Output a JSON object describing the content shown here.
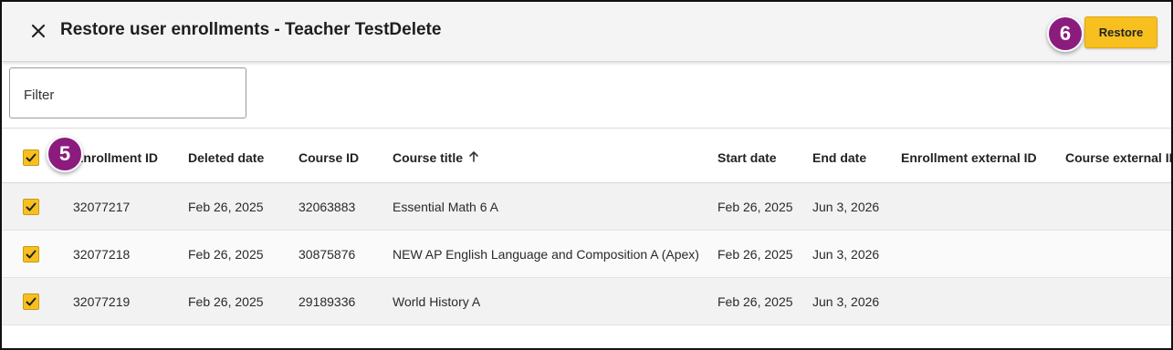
{
  "header": {
    "title": "Restore user enrollments - Teacher TestDelete",
    "close_icon": "close-icon",
    "restore_label": "Restore"
  },
  "annotations": {
    "badge_header": "6",
    "badge_select_all": "5"
  },
  "filter": {
    "placeholder": "Filter"
  },
  "table": {
    "columns": [
      "Enrollment ID",
      "Deleted date",
      "Course ID",
      "Course title",
      "Start date",
      "End date",
      "Enrollment external ID",
      "Course external ID"
    ],
    "sort_icon": "arrow-up-icon",
    "rows": [
      {
        "enrollment_id": "32077217",
        "deleted_date": "Feb 26, 2025",
        "course_id": "32063883",
        "course_title": "Essential Math 6 A",
        "start_date": "Feb 26, 2025",
        "end_date": "Jun 3, 2026",
        "enrollment_external_id": "",
        "course_external_id": "",
        "checked": true
      },
      {
        "enrollment_id": "32077218",
        "deleted_date": "Feb 26, 2025",
        "course_id": "30875876",
        "course_title": "NEW AP English Language and Composition A (Apex)",
        "start_date": "Feb 26, 2025",
        "end_date": "Jun 3, 2026",
        "enrollment_external_id": "",
        "course_external_id": "",
        "checked": true
      },
      {
        "enrollment_id": "32077219",
        "deleted_date": "Feb 26, 2025",
        "course_id": "29189336",
        "course_title": "World History A",
        "start_date": "Feb 26, 2025",
        "end_date": "Jun 3, 2026",
        "enrollment_external_id": "",
        "course_external_id": "",
        "checked": true
      }
    ]
  },
  "colors": {
    "accent": "#f7c01f",
    "badge": "#8b1c7e"
  }
}
